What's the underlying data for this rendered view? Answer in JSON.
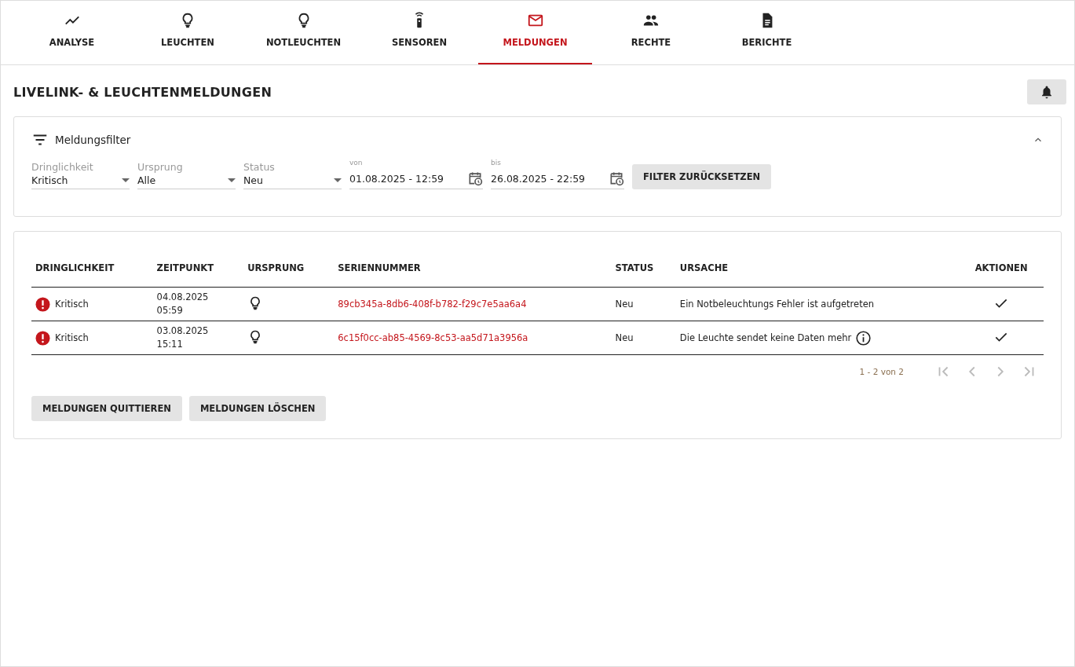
{
  "tabs": [
    {
      "label": "ANALYSE",
      "kind": "chart",
      "selected": false
    },
    {
      "label": "LEUCHTEN",
      "kind": "bulb",
      "selected": false
    },
    {
      "label": "NOTLEUCHTEN",
      "kind": "bulb",
      "selected": false
    },
    {
      "label": "SENSOREN",
      "kind": "sensor",
      "selected": false
    },
    {
      "label": "MELDUNGEN",
      "kind": "mail",
      "selected": true
    },
    {
      "label": "RECHTE",
      "kind": "people",
      "selected": false
    },
    {
      "label": "BERICHTE",
      "kind": "doc",
      "selected": false
    }
  ],
  "page_title": "LIVELINK- & LEUCHTENMELDUNGEN",
  "filter": {
    "title": "Meldungsfilter",
    "expanded": true,
    "fields": [
      {
        "kind": "select",
        "label": "Dringlichkeit",
        "value": "Kritisch"
      },
      {
        "kind": "select",
        "label": "Ursprung",
        "value": "Alle"
      },
      {
        "kind": "select",
        "label": "Status",
        "value": "Neu"
      },
      {
        "kind": "date",
        "label": "von",
        "value": "01.08.2025 - 12:59"
      },
      {
        "kind": "date",
        "label": "bis",
        "value": "26.08.2025 - 22:59"
      }
    ],
    "reset_button": "FILTER ZURÜCKSETZEN"
  },
  "table": {
    "columns": [
      "DRINGLICHKEIT",
      "ZEITPUNKT",
      "URSPRUNG",
      "SERIENNUMMER",
      "STATUS",
      "URSACHE",
      "AKTIONEN"
    ],
    "rows": [
      {
        "urgency": "Kritisch",
        "date": "04.08.2025",
        "time": "05:59",
        "serial": "89cb345a-8db6-408f-b782-f29c7e5aa6a4",
        "status": "Neu",
        "cause": "Ein Notbeleuchtungs Fehler ist aufgetreten",
        "info": false
      },
      {
        "urgency": "Kritisch",
        "date": "03.08.2025",
        "time": "15:11",
        "serial": "6c15f0cc-ab85-4569-8c53-aa5d71a3956a",
        "status": "Neu",
        "cause": "Die Leuchte sendet keine Daten mehr",
        "info": true
      }
    ]
  },
  "pagination": {
    "range": "1 - 2 von 2",
    "buttons": [
      {
        "kind": "first",
        "disabled": true
      },
      {
        "kind": "prev",
        "disabled": true
      },
      {
        "kind": "next",
        "disabled": true
      },
      {
        "kind": "last",
        "disabled": true
      }
    ]
  },
  "buttons": [
    "MELDUNGEN QUITTIEREN",
    "MELDUNGEN LÖSCHEN"
  ]
}
